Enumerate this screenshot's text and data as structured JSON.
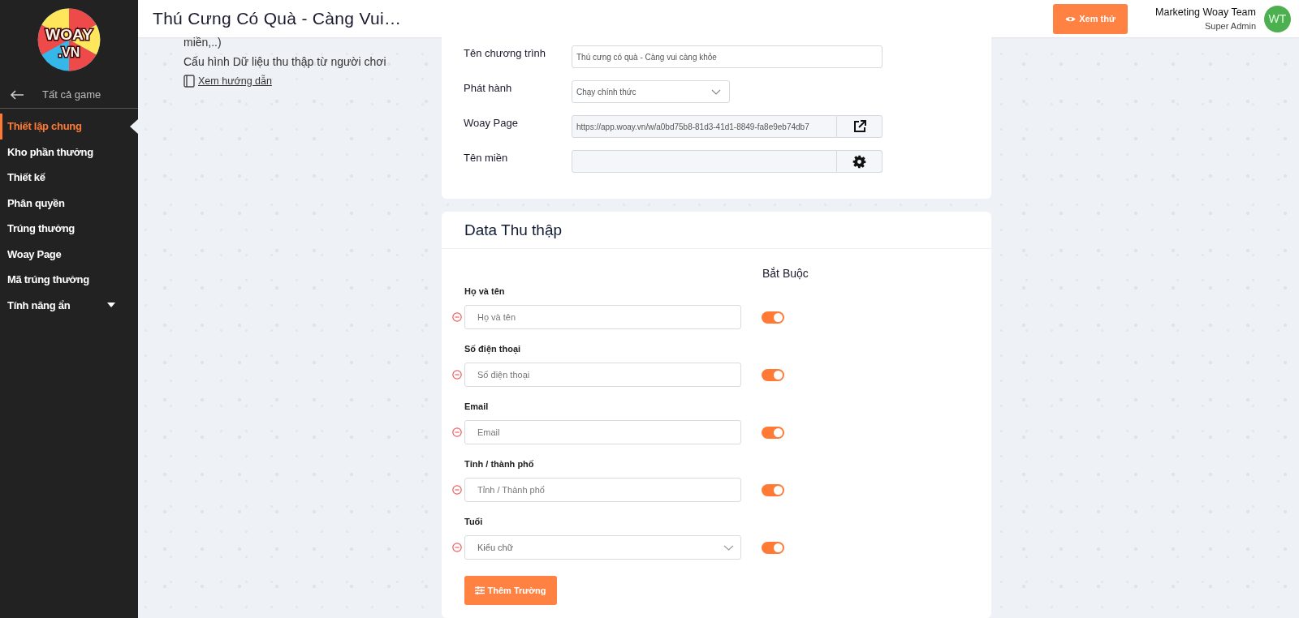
{
  "sidebar": {
    "logo": [
      "WOAY",
      ".VN"
    ],
    "back_link": "Tất cả game",
    "items": [
      {
        "label": "Thiết lập chung",
        "selected": true,
        "kind": "link"
      },
      {
        "label": "Kho phần thưởng",
        "selected": false,
        "kind": "link"
      },
      {
        "label": "Thiết kế",
        "selected": false,
        "kind": "link"
      },
      {
        "label": "Phân quyền",
        "selected": false,
        "kind": "link"
      },
      {
        "label": "Trúng thưởng",
        "selected": false,
        "kind": "link"
      },
      {
        "label": "Woay Page",
        "selected": false,
        "kind": "link"
      },
      {
        "label": "Mã trúng thưởng",
        "selected": false,
        "kind": "link"
      },
      {
        "label": "Tính năng ẩn",
        "selected": false,
        "kind": "group"
      }
    ]
  },
  "header": {
    "title": "Thú Cưng Có Quà - Càng Vui…",
    "preview_button": "Xem thử",
    "user": {
      "name": "Marketing Woay Team",
      "role": "Super Admin",
      "initials": "WT"
    }
  },
  "intro": {
    "lines": [
      "miền,..)",
      "Cấu hình Dữ liệu thu thập từ người chơi"
    ],
    "guide_link": "Xem hướng dẫn"
  },
  "settings": {
    "fields": [
      {
        "label": "Tên chương trình",
        "kind": "text",
        "value": "Thú cưng có quà - Càng vui càng khỏe"
      },
      {
        "label": "Phát hành",
        "kind": "select",
        "value": "Chạy chính thức"
      },
      {
        "label": "Woay Page",
        "kind": "link",
        "value": "https://app.woay.vn/w/a0bd75b8-81d3-41d1-8849-fa8e9eb74db7"
      },
      {
        "label": "Tên miền",
        "kind": "domain"
      }
    ]
  },
  "collect": {
    "title": "Data Thu thập",
    "required_heading": "Bắt Buộc",
    "fields": [
      {
        "label": "Họ và tên",
        "kind": "text",
        "placeholder": "Họ và tên",
        "required": true
      },
      {
        "label": "Số điện thoại",
        "kind": "text",
        "placeholder": "Số điện thoại",
        "required": true
      },
      {
        "label": "Email",
        "kind": "text",
        "placeholder": "Email",
        "required": true
      },
      {
        "label": "Tỉnh / thành phố",
        "kind": "text",
        "placeholder": "Tỉnh / Thành phố",
        "required": true
      },
      {
        "label": "Tuổi",
        "kind": "select",
        "value": "Kiểu chữ",
        "required": true
      }
    ],
    "add_button": "Thêm Trường"
  }
}
